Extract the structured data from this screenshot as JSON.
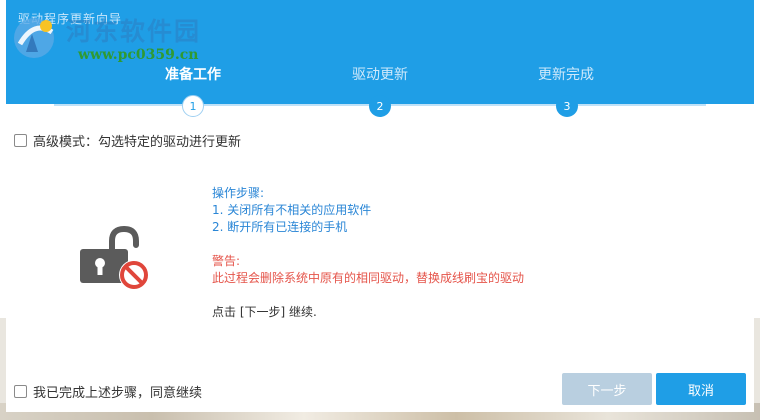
{
  "window": {
    "title": "驱动程序更新向导"
  },
  "watermark": {
    "site_name": "河东软件园",
    "url": "www.pc0359.cn"
  },
  "steps": [
    {
      "label": "准备工作",
      "number": "1",
      "active": true
    },
    {
      "label": "驱动更新",
      "number": "2",
      "active": false
    },
    {
      "label": "更新完成",
      "number": "3",
      "active": false
    }
  ],
  "advanced_mode": {
    "label": "高级模式：勾选特定的驱动进行更新",
    "checked": false
  },
  "instructions": {
    "steps_heading": "操作步骤:",
    "step1": "1. 关闭所有不相关的应用软件",
    "step2": "2. 断开所有已连接的手机",
    "warning_heading": "警告:",
    "warning_text": "此过程会删除系统中原有的相同驱动，替换成线刷宝的驱动",
    "continue_text": "点击 [下一步] 继续."
  },
  "confirm": {
    "label": "我已完成上述步骤，同意继续",
    "checked": false
  },
  "buttons": {
    "next": "下一步",
    "cancel": "取消"
  },
  "colors": {
    "header": "#1f9ee6",
    "info_text": "#2a86d6",
    "warning_text": "#e5544a",
    "next_disabled": "#b9cfe0"
  }
}
